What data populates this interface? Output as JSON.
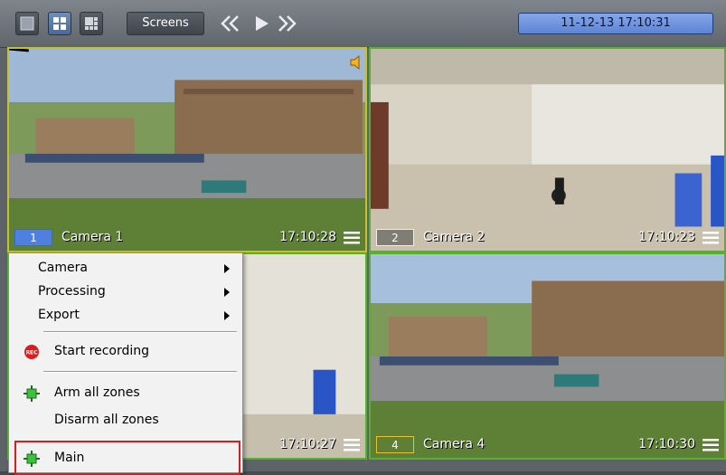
{
  "toolbar": {
    "layout_buttons": [
      "layout-1x1-icon",
      "layout-2x2-icon",
      "layout-1plus5-icon"
    ],
    "screens_label": "Screens",
    "nav_icons": [
      "rewind-icon",
      "play-icon",
      "fast-forward-icon"
    ],
    "datetime": "11-12-13  17:10:31"
  },
  "cameras": [
    {
      "number": "1",
      "name": "Camera 1",
      "time": "17:10:28"
    },
    {
      "number": "2",
      "name": "Camera 2",
      "time": "17:10:23"
    },
    {
      "number": "",
      "name": "",
      "time": "17:10:27"
    },
    {
      "number": "4",
      "name": "Camera 4",
      "time": "17:10:30"
    }
  ],
  "context_menu": {
    "items": [
      {
        "label": "Camera",
        "submenu": true
      },
      {
        "label": "Processing",
        "submenu": true
      },
      {
        "label": "Export",
        "submenu": true
      },
      {
        "label": "Start recording",
        "icon": "rec-icon"
      },
      {
        "label": "Arm all zones",
        "icon": "zone-armed-icon"
      },
      {
        "label": "Disarm all zones"
      },
      {
        "label": "Main",
        "icon": "zone-armed-icon"
      }
    ],
    "rec_icon_text": "REC"
  },
  "colors": {
    "active_cell_border": "#c7c02a",
    "cell_border": "#55b32a",
    "highlight_border": "#e01a1a",
    "datetime_bg": "#6d90dc"
  }
}
